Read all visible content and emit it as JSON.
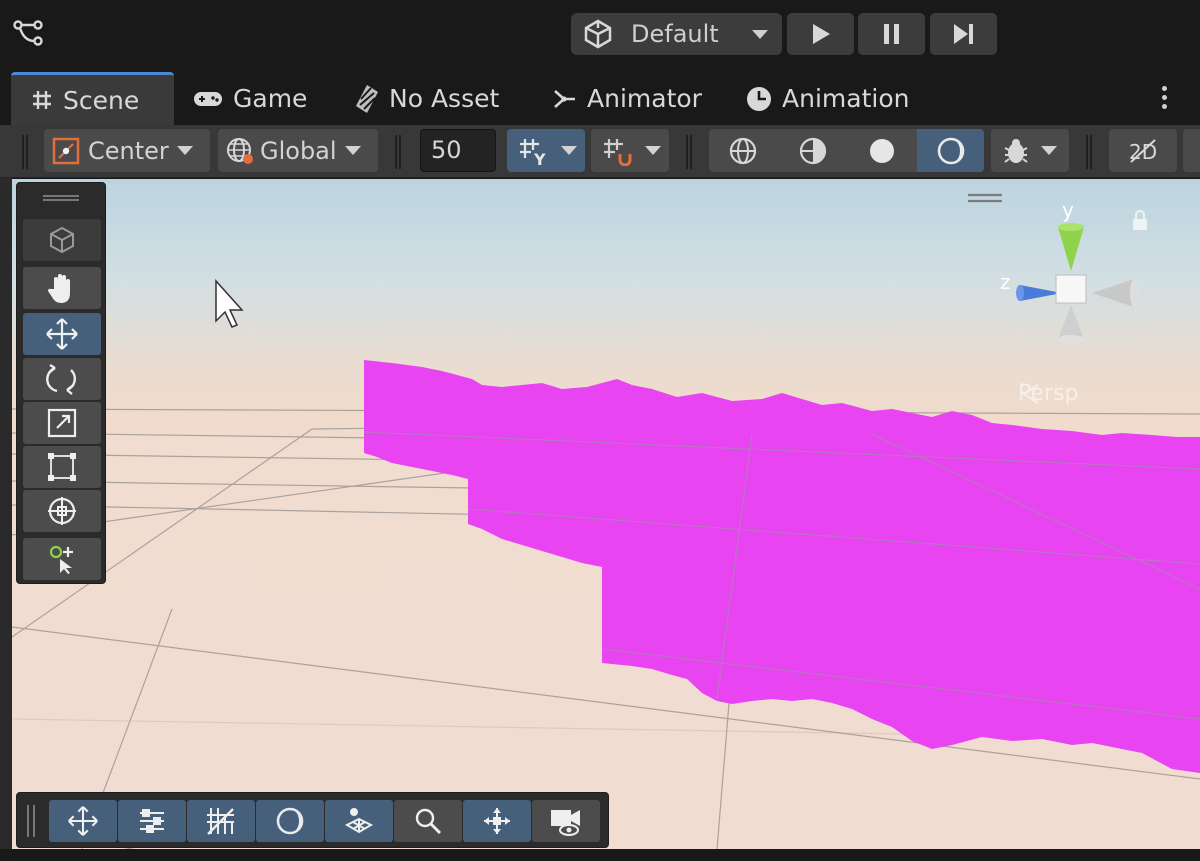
{
  "toolbar": {
    "layout_dropdown": "Default",
    "play_icon": "play-icon",
    "pause_icon": "pause-icon",
    "step_icon": "step-icon"
  },
  "tabs": [
    {
      "label": "Scene",
      "icon": "grid-hash-icon",
      "active": true
    },
    {
      "label": "Game",
      "icon": "gamepad-icon",
      "active": false
    },
    {
      "label": "No Asset",
      "icon": "asset-icon",
      "active": false
    },
    {
      "label": "Animator",
      "icon": "animator-icon",
      "active": false
    },
    {
      "label": "Animation",
      "icon": "clock-icon",
      "active": false
    }
  ],
  "scene_toolbar": {
    "pivot_label": "Center",
    "space_label": "Global",
    "grid_size": "50",
    "mode_2d": "2D"
  },
  "gizmo": {
    "y_label": "y",
    "z_label": "z",
    "projection_label": "Persp"
  },
  "colors": {
    "accent": "#46607c",
    "terrain": "#e844f2",
    "gizmo_y": "#8fd34a",
    "gizmo_z": "#4b7bd8",
    "sky": "#bcd4e0",
    "ground": "#f1dcd2"
  },
  "tool_palette": [
    "view-cube-icon",
    "hand-icon",
    "move-icon",
    "rotate-icon",
    "scale-icon",
    "rect-icon",
    "transform-icon",
    "custom-tool-icon"
  ],
  "bottom_overlay": [
    "move-icon",
    "sliders-icon",
    "grid-icon",
    "shading-icon",
    "layers-icon",
    "search-icon",
    "navigation-icon",
    "camera-icon"
  ]
}
